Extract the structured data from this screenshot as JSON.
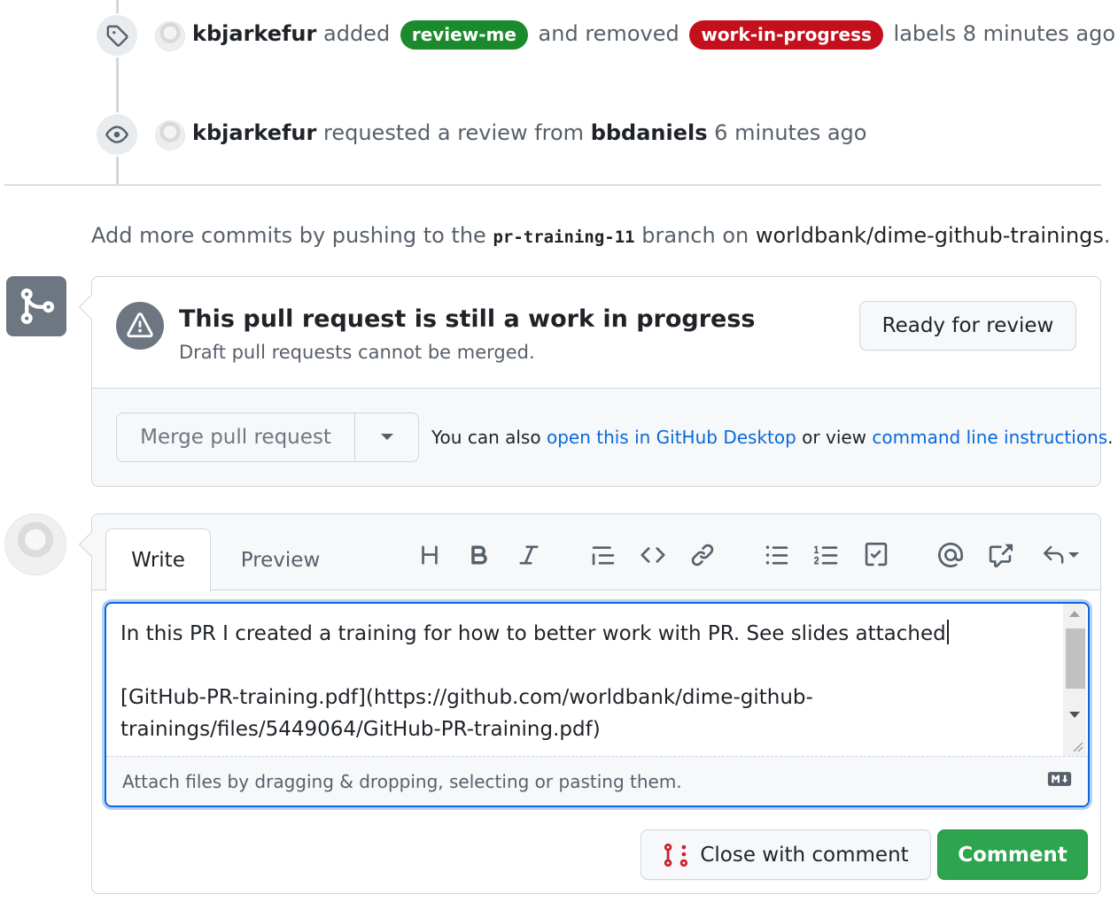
{
  "timeline": {
    "event1": {
      "user": "kbjarkefur",
      "verb": "added",
      "added_label": "review-me",
      "added_label_color": "#1a8a2c",
      "conjunction": "and removed",
      "removed_label": "work-in-progress",
      "removed_label_color": "#c4101c",
      "suffix": "labels",
      "time": "8 minutes ago"
    },
    "event2": {
      "user": "kbjarkefur",
      "verb": "requested a review from",
      "reviewer": "bbdaniels",
      "time": "6 minutes ago"
    }
  },
  "branch_note": {
    "prefix": "Add more commits by pushing to the",
    "branch": "pr-training-11",
    "middle": "branch on",
    "repo": "worldbank/dime-github-trainings",
    "suffix": "."
  },
  "merge_box": {
    "title": "This pull request is still a work in progress",
    "subtitle": "Draft pull requests cannot be merged.",
    "ready_button": "Ready for review",
    "merge_button": "Merge pull request",
    "hint_prefix": "You can also",
    "hint_link1": "open this in GitHub Desktop",
    "hint_middle": "or view",
    "hint_link2": "command line instructions",
    "hint_suffix": "."
  },
  "comment": {
    "tabs": [
      "Write",
      "Preview"
    ],
    "body": "In this PR I created a training for how to better work with PR. See slides attached\n\n[GitHub-PR-training.pdf](https://github.com/worldbank/dime-github-trainings/files/5449064/GitHub-PR-training.pdf)",
    "attach_hint": "Attach files by dragging & dropping, selecting or pasting them.",
    "close_button": "Close with comment",
    "comment_button": "Comment",
    "toolbar_icons": [
      "heading-icon",
      "bold-icon",
      "italic-icon",
      "quote-icon",
      "code-icon",
      "link-icon",
      "bulleted-list-icon",
      "numbered-list-icon",
      "task-list-icon",
      "mention-icon",
      "cross-reference-icon",
      "reply-icon"
    ]
  },
  "colors": {
    "accent_blue": "#0969da",
    "comment_green": "#2da44e",
    "close_red": "#cf222e"
  }
}
